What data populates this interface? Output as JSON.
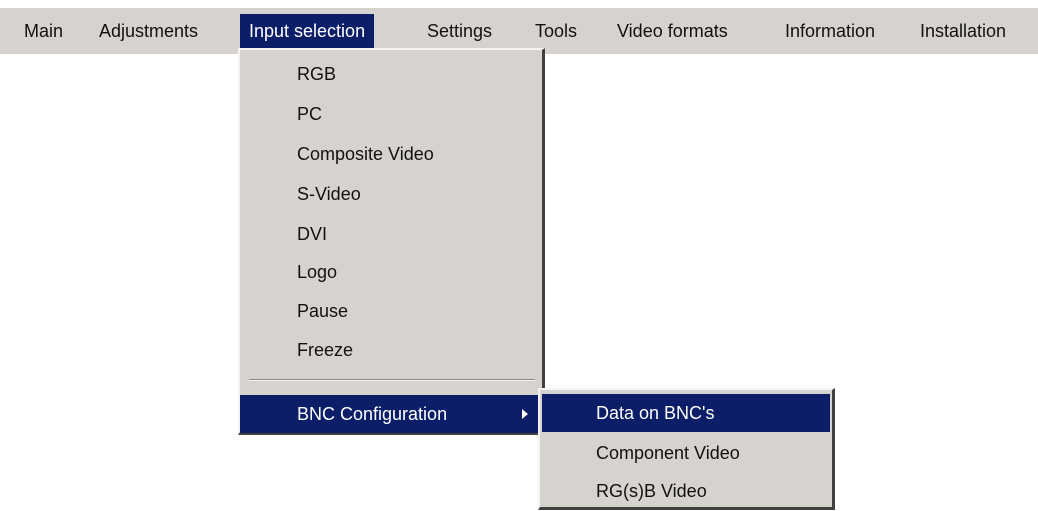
{
  "menubar": {
    "items": [
      {
        "label": "Main"
      },
      {
        "label": "Adjustments"
      },
      {
        "label": "Input selection",
        "active": true
      },
      {
        "label": "Settings"
      },
      {
        "label": "Tools"
      },
      {
        "label": "Video formats"
      },
      {
        "label": "Information"
      },
      {
        "label": "Installation"
      }
    ]
  },
  "input_selection_menu": {
    "items": [
      {
        "label": "RGB"
      },
      {
        "label": "PC"
      },
      {
        "label": "Composite Video"
      },
      {
        "label": "S-Video"
      },
      {
        "label": "DVI"
      },
      {
        "label": "Logo"
      },
      {
        "label": "Pause"
      },
      {
        "label": "Freeze"
      }
    ],
    "submenu_item": {
      "label": "BNC Configuration",
      "highlighted": true,
      "has_submenu": true
    }
  },
  "bnc_submenu": {
    "items": [
      {
        "label": "Data on BNC's",
        "highlighted": true
      },
      {
        "label": "Component Video"
      },
      {
        "label": "RG(s)B Video"
      }
    ]
  },
  "colors": {
    "menu_background": "#d6d3ce",
    "highlight": "#0b1e67",
    "highlight_text": "#ffffff"
  },
  "icons": {
    "submenu_arrow": "triangle-right-icon"
  }
}
